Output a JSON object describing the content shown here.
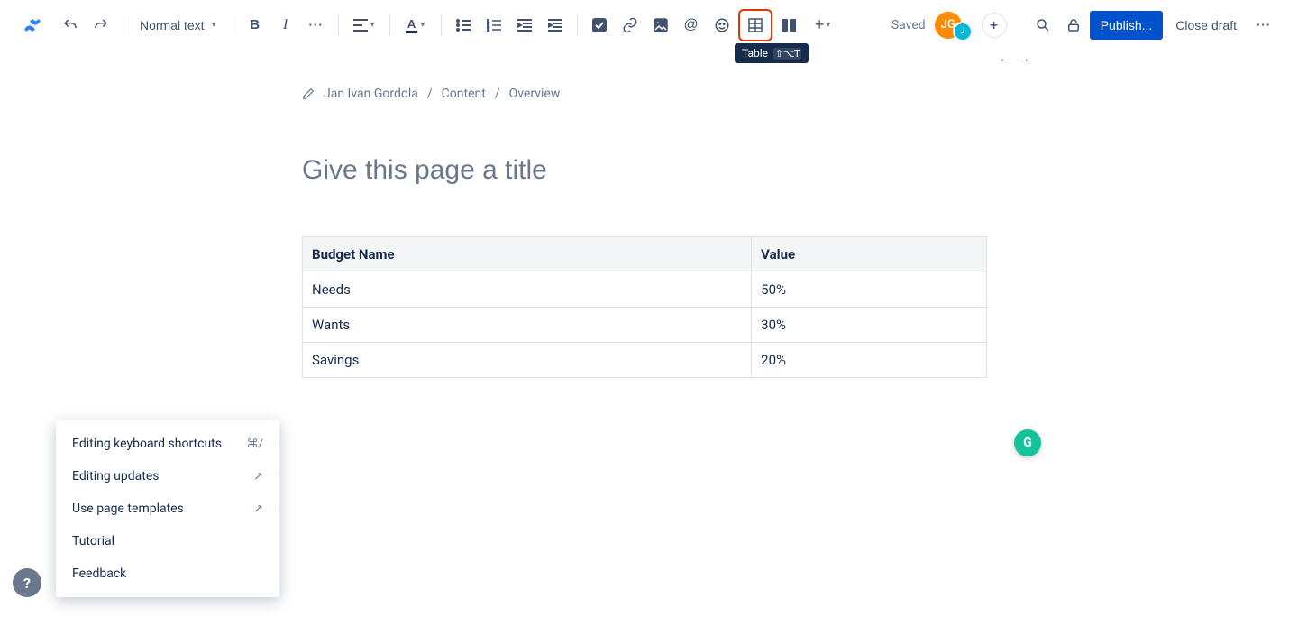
{
  "app": {
    "logo_color": "#2684FF"
  },
  "toolbar": {
    "text_style": "Normal text",
    "saved": "Saved",
    "avatar_initials": "JG",
    "publish": "Publish...",
    "close_draft": "Close draft"
  },
  "tooltip": {
    "label": "Table",
    "shortcut": "⇧⌥T"
  },
  "breadcrumb": {
    "author": "Jan Ivan Gordola",
    "parent": "Content",
    "current": "Overview"
  },
  "title_placeholder": "Give this page a title",
  "table": {
    "headers": [
      "Budget Name",
      "Value"
    ],
    "rows": [
      {
        "c0": "Needs",
        "c1": "50%"
      },
      {
        "c0": "Wants",
        "c1": "30%"
      },
      {
        "c0": "Savings",
        "c1": "20%"
      }
    ]
  },
  "grammarly": "G",
  "help_menu": {
    "item0": {
      "label": "Editing keyboard shortcuts",
      "hint": "⌘/"
    },
    "item1": {
      "label": "Editing updates"
    },
    "item2": {
      "label": "Use page templates"
    },
    "item3": {
      "label": "Tutorial"
    },
    "item4": {
      "label": "Feedback"
    }
  }
}
